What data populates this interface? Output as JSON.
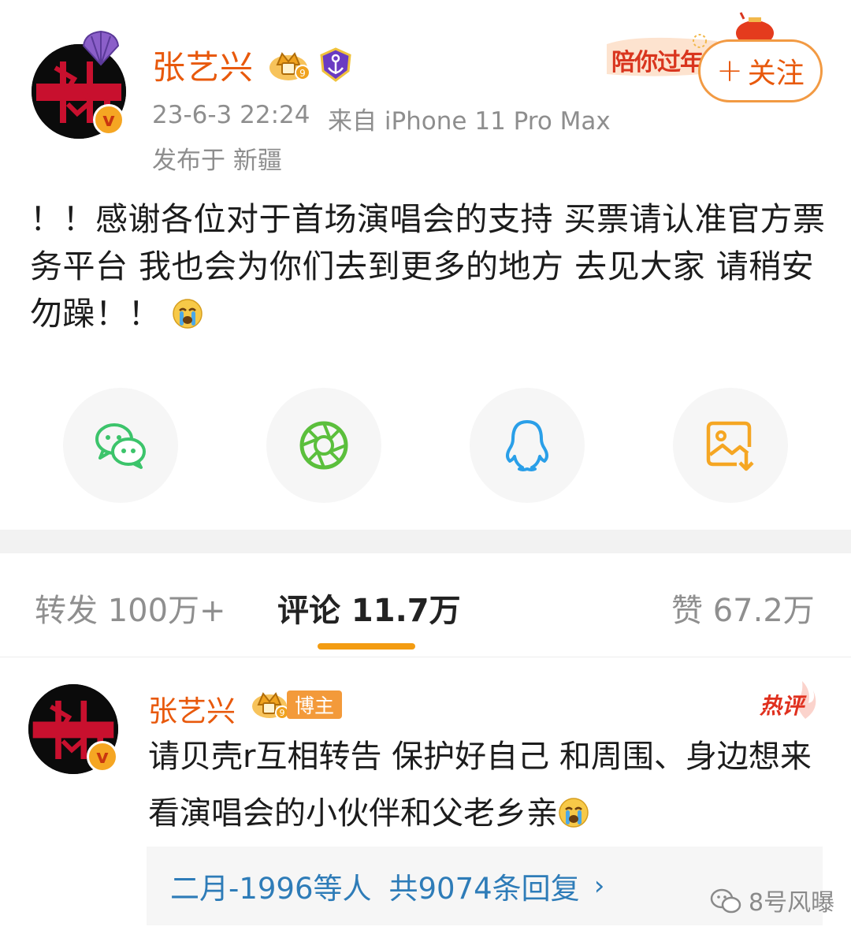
{
  "post": {
    "author": "张艺兴",
    "time": "23-6-3 22:24",
    "source": "来自 iPhone 11 Pro Max",
    "location": "发布于 新疆",
    "banner_text": "陪你过年",
    "follow_label": "关注",
    "follow_plus": "+",
    "text": "！！感谢各位对于首场演唱会的支持 买票请认准官方票务平台 我也会为你们去到更多的地方 去见大家 请稍安勿躁！！",
    "verified_mark": "v"
  },
  "share": [
    {
      "name": "wechat",
      "color": "#3cc46b"
    },
    {
      "name": "moments",
      "color": "#5bbf3c"
    },
    {
      "name": "qq",
      "color": "#2a9fe8"
    },
    {
      "name": "save-image",
      "color": "#f5a623"
    }
  ],
  "tabs": {
    "repost": "转发 100万+",
    "comments": "评论 11.7万",
    "likes": "赞 67.2万"
  },
  "comment": {
    "author": "张艺兴",
    "tag": "博主",
    "hot_label": "热评",
    "text": "请贝壳r互相转告 保护好自己 和周围、身边想来看演唱会的小伙伴和父老乡亲",
    "reply_users": "二月-1996等人",
    "reply_count": "共9074条回复",
    "reply_arrow": "›"
  },
  "watermark": "8号风曝"
}
